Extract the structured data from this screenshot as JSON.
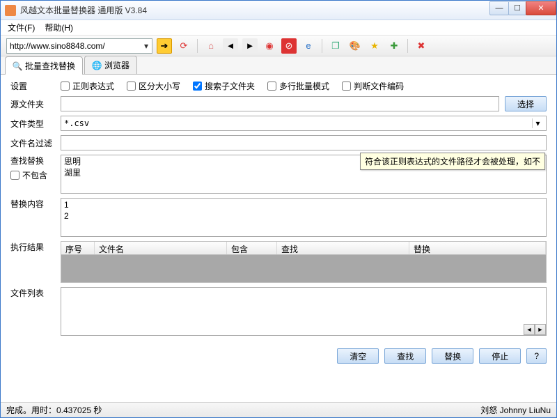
{
  "window": {
    "title": "风越文本批量替换器 通用版 V3.84"
  },
  "menu": {
    "file": "文件(F)",
    "help": "帮助(H)"
  },
  "url": "http://www.sino8848.com/",
  "tabs": {
    "findreplace": "批量查找替换",
    "browser": "浏览器"
  },
  "settings": {
    "label": "设置",
    "regex": "正则表达式",
    "case": "区分大小写",
    "subfolder": "搜索子文件夹",
    "multiline": "多行批量模式",
    "encoding": "判断文件编码"
  },
  "srcfolder": {
    "label": "源文件夹",
    "value": "",
    "choose": "选择"
  },
  "filetype": {
    "label": "文件类型",
    "value": "*.csv"
  },
  "namefilter": {
    "label": "文件名过滤",
    "value": ""
  },
  "findrep": {
    "label": "查找替换",
    "notcontain": "不包含",
    "text": "思明\n湖里"
  },
  "replace": {
    "label": "替换内容",
    "text": "1\n2"
  },
  "results": {
    "label": "执行结果",
    "cols": {
      "seq": "序号",
      "filename": "文件名",
      "contain": "包含",
      "find": "查找",
      "replace": "替换"
    }
  },
  "filelist": {
    "label": "文件列表"
  },
  "buttons": {
    "clear": "清空",
    "find": "查找",
    "replace": "替换",
    "stop": "停止",
    "help": "?"
  },
  "status": {
    "left": "完成。用时：0.437025 秒",
    "right": "刘怒 Johnny LiuNu"
  },
  "tooltip": "符合该正则表达式的文件路径才会被处理，如不"
}
